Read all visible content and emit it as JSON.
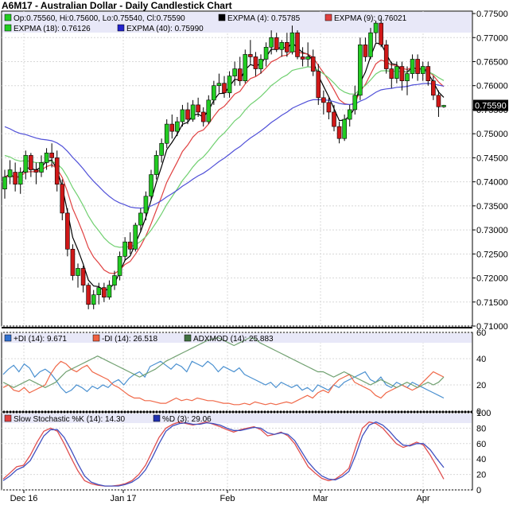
{
  "title": "A6M17 - Australian Dollar - Daily Candlestick Chart",
  "colors": {
    "up": "#22cc22",
    "down": "#d01818",
    "expma4": "#000000",
    "expma9": "#e04040",
    "expma18": "#70d070",
    "expma40": "#5050d8",
    "legend_bg": "#e8e8f8",
    "plus_di": "#4a90d0",
    "minus_di": "#f06848",
    "adx": "#70a070",
    "stoch_k": "#e05050",
    "stoch_d": "#4050c0"
  },
  "price_legend": [
    {
      "id": "ohlc",
      "text": "Op:0.75560, Hi:0.75600, Lo:0.75540, Cl:0.75590",
      "color": "#22cc22"
    },
    {
      "id": "expma4",
      "text": "EXPMA (4): 0.75785",
      "color": "#000000"
    },
    {
      "id": "expma9",
      "text": "EXPMA (9): 0.76021",
      "color": "#e04040"
    },
    {
      "id": "expma18",
      "text": "EXPMA (18): 0.76126",
      "color": "#22cc22"
    },
    {
      "id": "expma40",
      "text": "EXPMA (40): 0.75990",
      "color": "#2222cc"
    }
  ],
  "adx_legend": [
    {
      "id": "plus_di",
      "text": "+DI (14): 9.671",
      "color": "#3070d0"
    },
    {
      "id": "minus_di",
      "text": "-DI (14): 26.518",
      "color": "#f06040"
    },
    {
      "id": "adx",
      "text": "ADXMOD (14): 25.883",
      "color": "#407040"
    }
  ],
  "stoch_legend": [
    {
      "id": "stoch_k",
      "text": "Slow Stochastic %K (14): 14.30",
      "color": "#e04040"
    },
    {
      "id": "stoch_d",
      "text": "%D (3): 29.06",
      "color": "#2030b0"
    }
  ],
  "last_price_label": "0.75590",
  "x_labels": [
    "Dec 16",
    "Jan 17",
    "Feb",
    "Mar",
    "Apr"
  ],
  "chart_data": [
    {
      "type": "candlestick",
      "panel": "price",
      "ylim": [
        0.71,
        0.775
      ],
      "yticks": [
        "0.77500",
        "0.77000",
        "0.76500",
        "0.76000",
        "0.75500",
        "0.75000",
        "0.74500",
        "0.74000",
        "0.73500",
        "0.73000",
        "0.72500",
        "0.72000",
        "0.71500",
        "0.71000"
      ],
      "candles": [
        [
          0.7385,
          0.7425,
          0.7365,
          0.741
        ],
        [
          0.741,
          0.7445,
          0.7395,
          0.7425
        ],
        [
          0.742,
          0.744,
          0.738,
          0.7395
        ],
        [
          0.7395,
          0.743,
          0.7375,
          0.742
        ],
        [
          0.742,
          0.7465,
          0.7405,
          0.7455
        ],
        [
          0.7455,
          0.746,
          0.741,
          0.7425
        ],
        [
          0.7425,
          0.744,
          0.7395,
          0.742
        ],
        [
          0.742,
          0.7455,
          0.741,
          0.744
        ],
        [
          0.744,
          0.747,
          0.7425,
          0.746
        ],
        [
          0.746,
          0.748,
          0.743,
          0.745
        ],
        [
          0.745,
          0.7465,
          0.738,
          0.7395
        ],
        [
          0.7395,
          0.7405,
          0.732,
          0.7335
        ],
        [
          0.7335,
          0.7345,
          0.7245,
          0.726
        ],
        [
          0.726,
          0.727,
          0.7195,
          0.7205
        ],
        [
          0.7205,
          0.723,
          0.718,
          0.722
        ],
        [
          0.722,
          0.7225,
          0.717,
          0.7185
        ],
        [
          0.7185,
          0.719,
          0.7135,
          0.7145
        ],
        [
          0.7145,
          0.7175,
          0.7135,
          0.7165
        ],
        [
          0.7165,
          0.719,
          0.7145,
          0.718
        ],
        [
          0.718,
          0.719,
          0.715,
          0.716
        ],
        [
          0.716,
          0.7195,
          0.7155,
          0.7185
        ],
        [
          0.7185,
          0.7215,
          0.7175,
          0.7205
        ],
        [
          0.7205,
          0.7255,
          0.7195,
          0.7245
        ],
        [
          0.7245,
          0.7285,
          0.7235,
          0.7275
        ],
        [
          0.7275,
          0.7295,
          0.725,
          0.726
        ],
        [
          0.726,
          0.7315,
          0.7255,
          0.731
        ],
        [
          0.731,
          0.7345,
          0.7295,
          0.7335
        ],
        [
          0.7335,
          0.738,
          0.732,
          0.737
        ],
        [
          0.737,
          0.7425,
          0.736,
          0.7415
        ],
        [
          0.7415,
          0.7465,
          0.7405,
          0.7455
        ],
        [
          0.7455,
          0.749,
          0.744,
          0.748
        ],
        [
          0.748,
          0.753,
          0.747,
          0.752
        ],
        [
          0.752,
          0.754,
          0.749,
          0.7505
        ],
        [
          0.7505,
          0.7535,
          0.7495,
          0.7525
        ],
        [
          0.7525,
          0.756,
          0.7515,
          0.755
        ],
        [
          0.755,
          0.7565,
          0.752,
          0.753
        ],
        [
          0.753,
          0.757,
          0.7525,
          0.756
        ],
        [
          0.756,
          0.7575,
          0.7535,
          0.7545
        ],
        [
          0.7545,
          0.7555,
          0.7515,
          0.7525
        ],
        [
          0.7525,
          0.758,
          0.752,
          0.757
        ],
        [
          0.757,
          0.761,
          0.756,
          0.76
        ],
        [
          0.76,
          0.7625,
          0.7585,
          0.7605
        ],
        [
          0.7605,
          0.762,
          0.7575,
          0.7585
        ],
        [
          0.7585,
          0.763,
          0.7575,
          0.762
        ],
        [
          0.762,
          0.765,
          0.76,
          0.7635
        ],
        [
          0.7635,
          0.766,
          0.76,
          0.761
        ],
        [
          0.761,
          0.7675,
          0.7605,
          0.7665
        ],
        [
          0.7665,
          0.7695,
          0.7645,
          0.766
        ],
        [
          0.766,
          0.767,
          0.762,
          0.7635
        ],
        [
          0.7635,
          0.7665,
          0.7625,
          0.7655
        ],
        [
          0.7655,
          0.769,
          0.764,
          0.768
        ],
        [
          0.768,
          0.7715,
          0.7665,
          0.77
        ],
        [
          0.77,
          0.771,
          0.767,
          0.7675
        ],
        [
          0.7675,
          0.7695,
          0.766,
          0.769
        ],
        [
          0.769,
          0.771,
          0.766,
          0.767
        ],
        [
          0.767,
          0.7725,
          0.7665,
          0.771
        ],
        [
          0.771,
          0.7715,
          0.7655,
          0.766
        ],
        [
          0.766,
          0.768,
          0.764,
          0.7655
        ],
        [
          0.7655,
          0.769,
          0.764,
          0.766
        ],
        [
          0.766,
          0.7675,
          0.762,
          0.763
        ],
        [
          0.763,
          0.7645,
          0.756,
          0.7575
        ],
        [
          0.7575,
          0.759,
          0.754,
          0.7565
        ],
        [
          0.7565,
          0.7575,
          0.753,
          0.7545
        ],
        [
          0.7545,
          0.756,
          0.7505,
          0.7515
        ],
        [
          0.7515,
          0.7525,
          0.748,
          0.749
        ],
        [
          0.749,
          0.754,
          0.7485,
          0.753
        ],
        [
          0.753,
          0.756,
          0.7515,
          0.755
        ],
        [
          0.755,
          0.76,
          0.754,
          0.758
        ],
        [
          0.758,
          0.77,
          0.757,
          0.7685
        ],
        [
          0.7685,
          0.77,
          0.765,
          0.766
        ],
        [
          0.766,
          0.772,
          0.7655,
          0.771
        ],
        [
          0.771,
          0.7735,
          0.769,
          0.773
        ],
        [
          0.773,
          0.774,
          0.768,
          0.7685
        ],
        [
          0.7685,
          0.7695,
          0.7625,
          0.7635
        ],
        [
          0.7635,
          0.765,
          0.7595,
          0.7615
        ],
        [
          0.7615,
          0.765,
          0.7605,
          0.764
        ],
        [
          0.764,
          0.765,
          0.759,
          0.761
        ],
        [
          0.761,
          0.764,
          0.758,
          0.7625
        ],
        [
          0.7625,
          0.7665,
          0.7615,
          0.7655
        ],
        [
          0.7655,
          0.7665,
          0.761,
          0.7625
        ],
        [
          0.7625,
          0.765,
          0.761,
          0.764
        ],
        [
          0.764,
          0.765,
          0.76,
          0.761
        ],
        [
          0.761,
          0.762,
          0.757,
          0.758
        ],
        [
          0.758,
          0.759,
          0.7535,
          0.7556
        ],
        [
          0.7556,
          0.756,
          0.7554,
          0.7559
        ]
      ]
    },
    {
      "type": "line",
      "panel": "adx",
      "ylim": [
        0,
        60
      ],
      "yticks": [
        "60",
        "40",
        "20",
        "0"
      ],
      "series": [
        {
          "name": "+DI (14)",
          "values": [
            28,
            32,
            35,
            30,
            36,
            33,
            26,
            30,
            32,
            29,
            24,
            18,
            14,
            16,
            20,
            18,
            15,
            19,
            17,
            20,
            18,
            22,
            24,
            20,
            25,
            28,
            30,
            26,
            34,
            36,
            38,
            35,
            32,
            36,
            34,
            30,
            38,
            36,
            34,
            38,
            35,
            30,
            34,
            32,
            30,
            33,
            28,
            26,
            24,
            22,
            20,
            22,
            18,
            22,
            20,
            18,
            20,
            16,
            18,
            15,
            20,
            18,
            16,
            20,
            18,
            22,
            24,
            26,
            28,
            30,
            24,
            22,
            26,
            20,
            18,
            22,
            20,
            18,
            22,
            20,
            18,
            16,
            14,
            12,
            10
          ]
        },
        {
          "name": "-DI (14)",
          "values": [
            18,
            20,
            16,
            15,
            18,
            14,
            16,
            18,
            20,
            28,
            34,
            38,
            36,
            32,
            30,
            33,
            35,
            30,
            28,
            26,
            24,
            20,
            18,
            15,
            12,
            10,
            10,
            8,
            8,
            7,
            6,
            6,
            8,
            10,
            8,
            9,
            8,
            10,
            9,
            8,
            8,
            7,
            6,
            6,
            5,
            5,
            6,
            5,
            7,
            6,
            5,
            6,
            5,
            6,
            7,
            6,
            8,
            10,
            12,
            10,
            14,
            16,
            14,
            20,
            24,
            26,
            28,
            22,
            20,
            18,
            16,
            12,
            10,
            14,
            16,
            18,
            20,
            18,
            16,
            18,
            22,
            26,
            30,
            28,
            26
          ]
        },
        {
          "name": "ADXMOD (14)",
          "values": [
            22,
            20,
            18,
            20,
            22,
            24,
            22,
            20,
            18,
            20,
            22,
            26,
            30,
            32,
            34,
            36,
            38,
            40,
            42,
            40,
            38,
            36,
            34,
            32,
            30,
            28,
            26,
            28,
            30,
            32,
            35,
            38,
            40,
            42,
            44,
            46,
            48,
            50,
            52,
            54,
            55,
            56,
            54,
            52,
            50,
            52,
            54,
            56,
            55,
            52,
            50,
            48,
            46,
            44,
            42,
            40,
            38,
            36,
            34,
            32,
            30,
            30,
            28,
            26,
            28,
            30,
            28,
            26,
            24,
            22,
            20,
            22,
            24,
            22,
            20,
            18,
            20,
            22,
            20,
            18,
            20,
            22,
            20,
            22,
            26
          ]
        }
      ]
    },
    {
      "type": "line",
      "panel": "stochastic",
      "ylim": [
        0,
        100
      ],
      "yticks": [
        "100",
        "80",
        "60",
        "40",
        "20",
        "0"
      ],
      "series": [
        {
          "name": "Slow Stochastic %K (14)",
          "values": [
            14,
            22,
            30,
            32,
            45,
            62,
            76,
            80,
            76,
            60,
            42,
            25,
            12,
            8,
            6,
            5,
            5,
            6,
            8,
            12,
            20,
            32,
            50,
            68,
            80,
            85,
            88,
            86,
            84,
            86,
            88,
            85,
            82,
            78,
            75,
            78,
            80,
            82,
            78,
            70,
            72,
            75,
            70,
            60,
            45,
            30,
            22,
            15,
            12,
            14,
            20,
            28,
            55,
            80,
            88,
            86,
            80,
            70,
            60,
            55,
            58,
            62,
            58,
            45,
            30,
            14
          ]
        },
        {
          "name": "%D (3)",
          "values": [
            12,
            18,
            26,
            30,
            38,
            54,
            70,
            78,
            78,
            68,
            52,
            34,
            18,
            10,
            7,
            5,
            5,
            5,
            7,
            10,
            16,
            26,
            42,
            60,
            76,
            83,
            86,
            87,
            85,
            85,
            87,
            86,
            84,
            80,
            77,
            77,
            79,
            81,
            80,
            74,
            72,
            74,
            72,
            64,
            50,
            36,
            26,
            18,
            14,
            13,
            17,
            24,
            45,
            70,
            84,
            88,
            84,
            76,
            66,
            58,
            57,
            60,
            60,
            52,
            40,
            29
          ]
        }
      ]
    }
  ]
}
